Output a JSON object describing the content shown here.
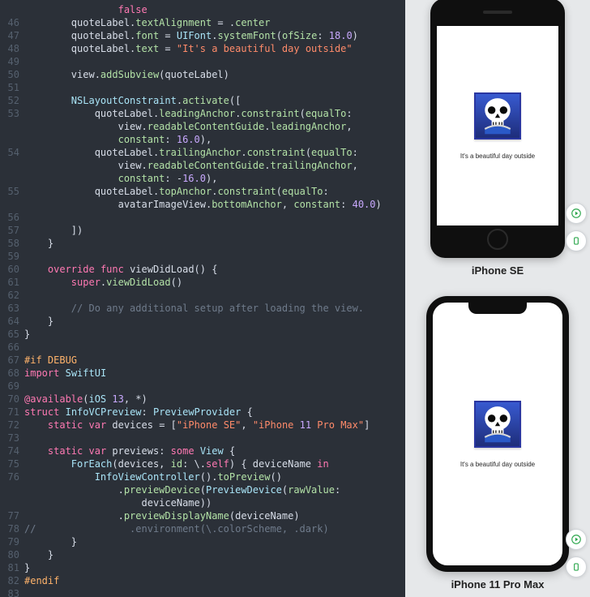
{
  "editor": {
    "line_start": 46,
    "lines": [
      {
        "n": "",
        "t": "                false"
      },
      {
        "n": 46,
        "t": "        quoteLabel.textAlignment = .center"
      },
      {
        "n": 47,
        "t": "        quoteLabel.font = UIFont.systemFont(ofSize: 18.0)"
      },
      {
        "n": 48,
        "t": "        quoteLabel.text = \"It's a beautiful day outside\""
      },
      {
        "n": 49,
        "t": ""
      },
      {
        "n": 50,
        "t": "        view.addSubview(quoteLabel)"
      },
      {
        "n": 51,
        "t": ""
      },
      {
        "n": 52,
        "t": "        NSLayoutConstraint.activate(["
      },
      {
        "n": 53,
        "t": "            quoteLabel.leadingAnchor.constraint(equalTo:"
      },
      {
        "n": "",
        "t": "                view.readableContentGuide.leadingAnchor,"
      },
      {
        "n": "",
        "t": "                constant: 16.0),"
      },
      {
        "n": 54,
        "t": "            quoteLabel.trailingAnchor.constraint(equalTo:"
      },
      {
        "n": "",
        "t": "                view.readableContentGuide.trailingAnchor,"
      },
      {
        "n": "",
        "t": "                constant: -16.0),"
      },
      {
        "n": 55,
        "t": "            quoteLabel.topAnchor.constraint(equalTo:"
      },
      {
        "n": "",
        "t": "                avatarImageView.bottomAnchor, constant: 40.0)"
      },
      {
        "n": 56,
        "t": ""
      },
      {
        "n": 57,
        "t": "        ])"
      },
      {
        "n": 58,
        "t": "    }"
      },
      {
        "n": 59,
        "t": ""
      },
      {
        "n": 60,
        "t": "    override func viewDidLoad() {"
      },
      {
        "n": 61,
        "t": "        super.viewDidLoad()"
      },
      {
        "n": 62,
        "t": ""
      },
      {
        "n": 63,
        "t": "        // Do any additional setup after loading the view."
      },
      {
        "n": 64,
        "t": "    }"
      },
      {
        "n": 65,
        "t": "}"
      },
      {
        "n": 66,
        "t": ""
      },
      {
        "n": 67,
        "t": "#if DEBUG"
      },
      {
        "n": 68,
        "t": "import SwiftUI"
      },
      {
        "n": 69,
        "t": ""
      },
      {
        "n": 70,
        "t": "@available(iOS 13, *)"
      },
      {
        "n": 71,
        "t": "struct InfoVCPreview: PreviewProvider {"
      },
      {
        "n": 72,
        "t": "    static var devices = [\"iPhone SE\", \"iPhone 11 Pro Max\"]"
      },
      {
        "n": 73,
        "t": ""
      },
      {
        "n": 74,
        "t": "    static var previews: some View {"
      },
      {
        "n": 75,
        "t": "        ForEach(devices, id: \\.self) { deviceName in"
      },
      {
        "n": 76,
        "t": "            InfoViewController().toPreview()"
      },
      {
        "n": "",
        "t": "                .previewDevice(PreviewDevice(rawValue:"
      },
      {
        "n": "",
        "t": "                    deviceName))"
      },
      {
        "n": 77,
        "t": "                .previewDisplayName(deviceName)"
      },
      {
        "n": 78,
        "t": "//                .environment(\\.colorScheme, .dark)"
      },
      {
        "n": 79,
        "t": "        }"
      },
      {
        "n": 80,
        "t": "    }"
      },
      {
        "n": 81,
        "t": "}"
      },
      {
        "n": 82,
        "t": "#endif"
      },
      {
        "n": 83,
        "t": ""
      }
    ]
  },
  "preview": {
    "device1": {
      "name": "iPhone SE",
      "quote": "It's a beautiful day outside"
    },
    "device2": {
      "name": "iPhone 11 Pro Max",
      "quote": "It's a beautiful day outside"
    }
  },
  "colors": {
    "keyword": "#ff79b3",
    "type": "#a9e4f7",
    "property": "#b3e2a7",
    "string": "#ff8b6a",
    "number": "#c9a9ff",
    "comment": "#6f7b8b",
    "preprocessor": "#ffb36b",
    "accent_green": "#2fa84f"
  }
}
